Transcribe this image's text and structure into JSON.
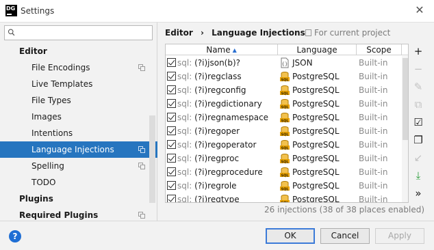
{
  "window": {
    "title": "Settings",
    "app_icon_text": "DG"
  },
  "sidebar": {
    "search": {
      "value": "",
      "placeholder": ""
    },
    "items": [
      {
        "label": "Editor",
        "level": 0,
        "selected": false,
        "copy": false
      },
      {
        "label": "File Encodings",
        "level": 1,
        "selected": false,
        "copy": true
      },
      {
        "label": "Live Templates",
        "level": 1,
        "selected": false,
        "copy": false
      },
      {
        "label": "File Types",
        "level": 1,
        "selected": false,
        "copy": false
      },
      {
        "label": "Images",
        "level": 1,
        "selected": false,
        "copy": false
      },
      {
        "label": "Intentions",
        "level": 1,
        "selected": false,
        "copy": false
      },
      {
        "label": "Language Injections",
        "level": 1,
        "selected": true,
        "copy": true
      },
      {
        "label": "Spelling",
        "level": 1,
        "selected": false,
        "copy": true
      },
      {
        "label": "TODO",
        "level": 1,
        "selected": false,
        "copy": false
      },
      {
        "label": "Plugins",
        "level": 0,
        "selected": false,
        "copy": false
      },
      {
        "label": "Required Plugins",
        "level": 0,
        "selected": false,
        "copy": true
      }
    ]
  },
  "breadcrumb": {
    "parent": "Editor",
    "separator": "›",
    "current": "Language Injections"
  },
  "scope_hint": "For current project",
  "table": {
    "columns": {
      "name": "Name",
      "language": "Language",
      "scope": "Scope"
    },
    "rows": [
      {
        "prefix": "sql:",
        "name": "(?i)json(b)?",
        "language": "JSON",
        "lang_icon": "json-icon",
        "scope": "Built-in",
        "checked": true
      },
      {
        "prefix": "sql:",
        "name": "(?i)regclass",
        "language": "PostgreSQL",
        "lang_icon": "sql-icon",
        "scope": "Built-in",
        "checked": true
      },
      {
        "prefix": "sql:",
        "name": "(?i)regconfig",
        "language": "PostgreSQL",
        "lang_icon": "sql-icon",
        "scope": "Built-in",
        "checked": true
      },
      {
        "prefix": "sql:",
        "name": "(?i)regdictionary",
        "language": "PostgreSQL",
        "lang_icon": "sql-icon",
        "scope": "Built-in",
        "checked": true
      },
      {
        "prefix": "sql:",
        "name": "(?i)regnamespace",
        "language": "PostgreSQL",
        "lang_icon": "sql-icon",
        "scope": "Built-in",
        "checked": true
      },
      {
        "prefix": "sql:",
        "name": "(?i)regoper",
        "language": "PostgreSQL",
        "lang_icon": "sql-icon",
        "scope": "Built-in",
        "checked": true
      },
      {
        "prefix": "sql:",
        "name": "(?i)regoperator",
        "language": "PostgreSQL",
        "lang_icon": "sql-icon",
        "scope": "Built-in",
        "checked": true
      },
      {
        "prefix": "sql:",
        "name": "(?i)regproc",
        "language": "PostgreSQL",
        "lang_icon": "sql-icon",
        "scope": "Built-in",
        "checked": true
      },
      {
        "prefix": "sql:",
        "name": "(?i)regprocedure",
        "language": "PostgreSQL",
        "lang_icon": "sql-icon",
        "scope": "Built-in",
        "checked": true
      },
      {
        "prefix": "sql:",
        "name": "(?i)regrole",
        "language": "PostgreSQL",
        "lang_icon": "sql-icon",
        "scope": "Built-in",
        "checked": true
      },
      {
        "prefix": "sql:",
        "name": "(?i)regtype",
        "language": "PostgreSQL",
        "lang_icon": "sql-icon",
        "scope": "Built-in",
        "checked": true
      }
    ]
  },
  "toolbar": [
    {
      "icon": "add-icon",
      "glyph": "+",
      "enabled": true
    },
    {
      "icon": "remove-icon",
      "glyph": "−",
      "enabled": false
    },
    {
      "icon": "edit-icon",
      "glyph": "✎",
      "enabled": false
    },
    {
      "icon": "copy-icon",
      "glyph": "⧉",
      "enabled": false
    },
    {
      "icon": "checklist-icon",
      "glyph": "☑",
      "enabled": true
    },
    {
      "icon": "duplicate-icon",
      "glyph": "❐",
      "enabled": true
    },
    {
      "icon": "import-icon",
      "glyph": "↙",
      "enabled": false
    },
    {
      "icon": "export-icon",
      "glyph": "⤓",
      "enabled": true
    },
    {
      "icon": "more-icon",
      "glyph": "»",
      "enabled": true
    }
  ],
  "status_text": "26 injections (38 of 38 places enabled)",
  "footer": {
    "help": "?",
    "ok": "OK",
    "cancel": "Cancel",
    "apply": "Apply"
  },
  "colors": {
    "selection": "#2675bf",
    "accent": "#3b7ad8",
    "sql_icon": "#e7a100",
    "enable_green": "#2a9d3a"
  }
}
